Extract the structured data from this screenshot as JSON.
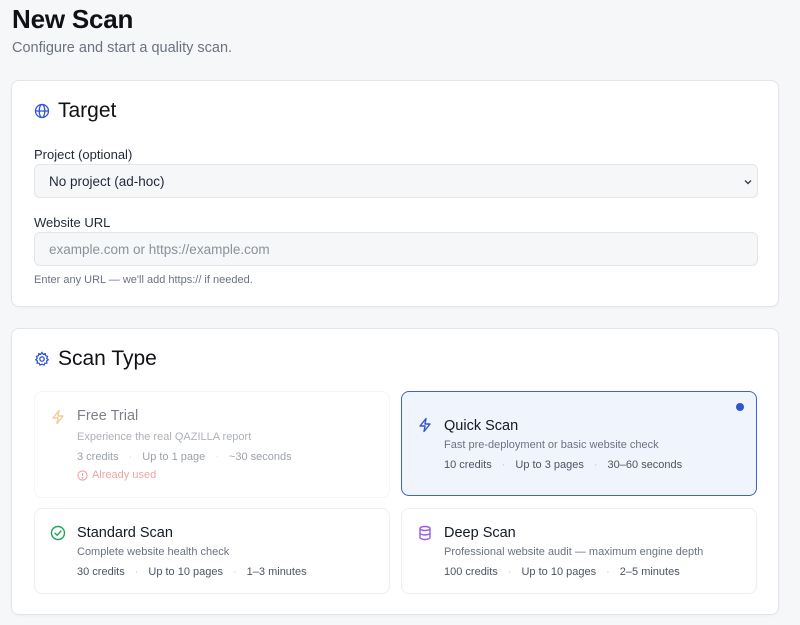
{
  "page": {
    "title": "New Scan",
    "subtitle": "Configure and start a quality scan."
  },
  "target": {
    "title": "Target",
    "icon": "globe-icon",
    "project_label": "Project (optional)",
    "project_value": "No project (ad-hoc)",
    "url_label": "Website URL",
    "url_placeholder": "example.com or https://example.com",
    "url_value": "",
    "hint": "Enter any URL — we'll add https:// if needed."
  },
  "scan_type": {
    "title": "Scan Type",
    "icon": "gear-icon",
    "accent": "#3b63d4",
    "options": [
      {
        "id": "free-trial",
        "title": "Free Trial",
        "description": "Experience the real QAZILLA report",
        "credits": "3 credits",
        "pages": "Up to 1 page",
        "time": "~30 seconds",
        "status": "Already used",
        "icon": "bolt-icon",
        "icon_color": "#e8a33c",
        "disabled": true,
        "selected": false
      },
      {
        "id": "quick-scan",
        "title": "Quick Scan",
        "description": "Fast pre-deployment or basic website check",
        "credits": "10 credits",
        "pages": "Up to 3 pages",
        "time": "30–60 seconds",
        "icon": "bolt-icon",
        "icon_color": "#2f55d4",
        "selected": true
      },
      {
        "id": "standard-scan",
        "title": "Standard Scan",
        "description": "Complete website health check",
        "credits": "30 credits",
        "pages": "Up to 10 pages",
        "time": "1–3 minutes",
        "icon": "check-circle-icon",
        "icon_color": "#22a35a",
        "selected": false
      },
      {
        "id": "deep-scan",
        "title": "Deep Scan",
        "description": "Professional website audit — maximum engine depth",
        "credits": "100 credits",
        "pages": "Up to 10 pages",
        "time": "2–5 minutes",
        "icon": "database-icon",
        "icon_color": "#9b5de5",
        "selected": false
      }
    ]
  }
}
